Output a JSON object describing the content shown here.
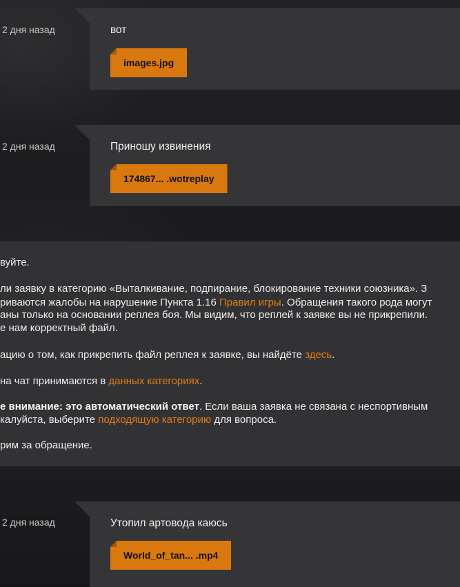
{
  "messages": [
    {
      "time": "2 дня назад",
      "text": "вот",
      "file": "images.jpg"
    },
    {
      "time": "2 дня назад",
      "text": "Приношу извинения",
      "file": "174867... .wotreplay"
    },
    {
      "time": "2 дня назад",
      "text": "Утопил артовода каюсь",
      "file": "World_of_tan... .mp4"
    }
  ],
  "support": {
    "greeting": "вуйте.",
    "p1_l1": "ли заявку в категорию «Выталкивание, подпирание, блокирование техники союзника». З",
    "p1_l2_before": "риваются жалобы на нарушение Пункта 1.16 ",
    "p1_l2_link": "Правил игры",
    "p1_l2_after": ". Обращения такого рода могут",
    "p1_l3": "аны только на основании реплея боя. Мы видим, что реплей к заявке вы не прикрепили.",
    "p1_l4": "е нам корректный файл.",
    "p2_before": "ацию о том, как прикрепить файл реплея к заявке, вы найдёте ",
    "p2_link": "здесь",
    "p2_after": ".",
    "p3_before": "на чат принимаются в ",
    "p3_link": "данных категориях",
    "p3_after": ".",
    "p4_bold": "е внимание: это автоматический ответ",
    "p4_after": ". Если ваша заявка не связана с неспортивным",
    "p4_l2_before": "калуйста, выберите ",
    "p4_l2_link": "подходящую категорию",
    "p4_l2_after": " для вопроса.",
    "p5": "рим за обращение."
  }
}
